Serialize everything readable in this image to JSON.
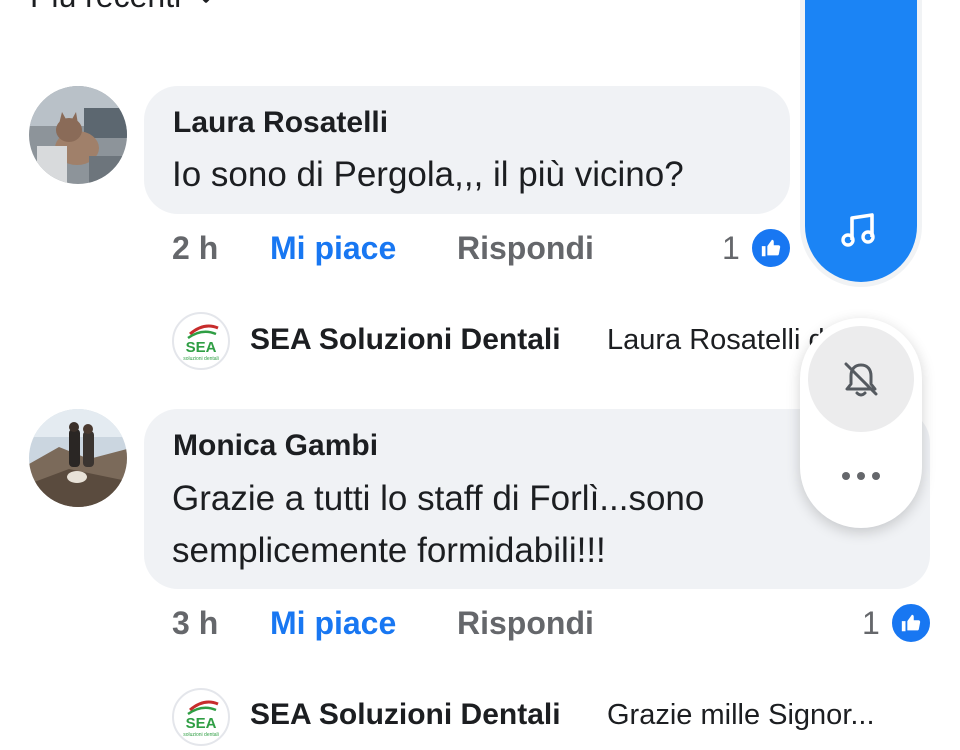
{
  "sort": {
    "label": "Più recenti"
  },
  "comments": [
    {
      "author": "Laura Rosatelli",
      "text": "Io sono di Pergola,,, il più vicino?",
      "time": "2 h",
      "like_label": "Mi piace",
      "reply_label": "Rispondi",
      "reactions": "1",
      "reply_preview": {
        "page": "SEA Soluzioni Dentali",
        "text": "Laura Rosatelli duo"
      }
    },
    {
      "author": "Monica Gambi",
      "text_lines": [
        "Grazie a tutti lo staff di Forlì...sono",
        "semplicemente formidabili!!!"
      ],
      "time": "3 h",
      "like_label": "Mi piace",
      "reply_label": "Rispondi",
      "reactions": "1",
      "reply_preview": {
        "page": "SEA Soluzioni Dentali",
        "text": "Grazie mille Signor..."
      }
    }
  ],
  "logo": {
    "text": "SEA",
    "subtext": "soluzioni dentali"
  },
  "colors": {
    "accent": "#1877f2",
    "panel_blue": "#1b84f5",
    "bubble": "#f0f2f5",
    "muted": "#65676b"
  },
  "icons": [
    "chevron-down-icon",
    "music-note-icon",
    "bell-off-icon",
    "more-icon",
    "like-icon"
  ]
}
